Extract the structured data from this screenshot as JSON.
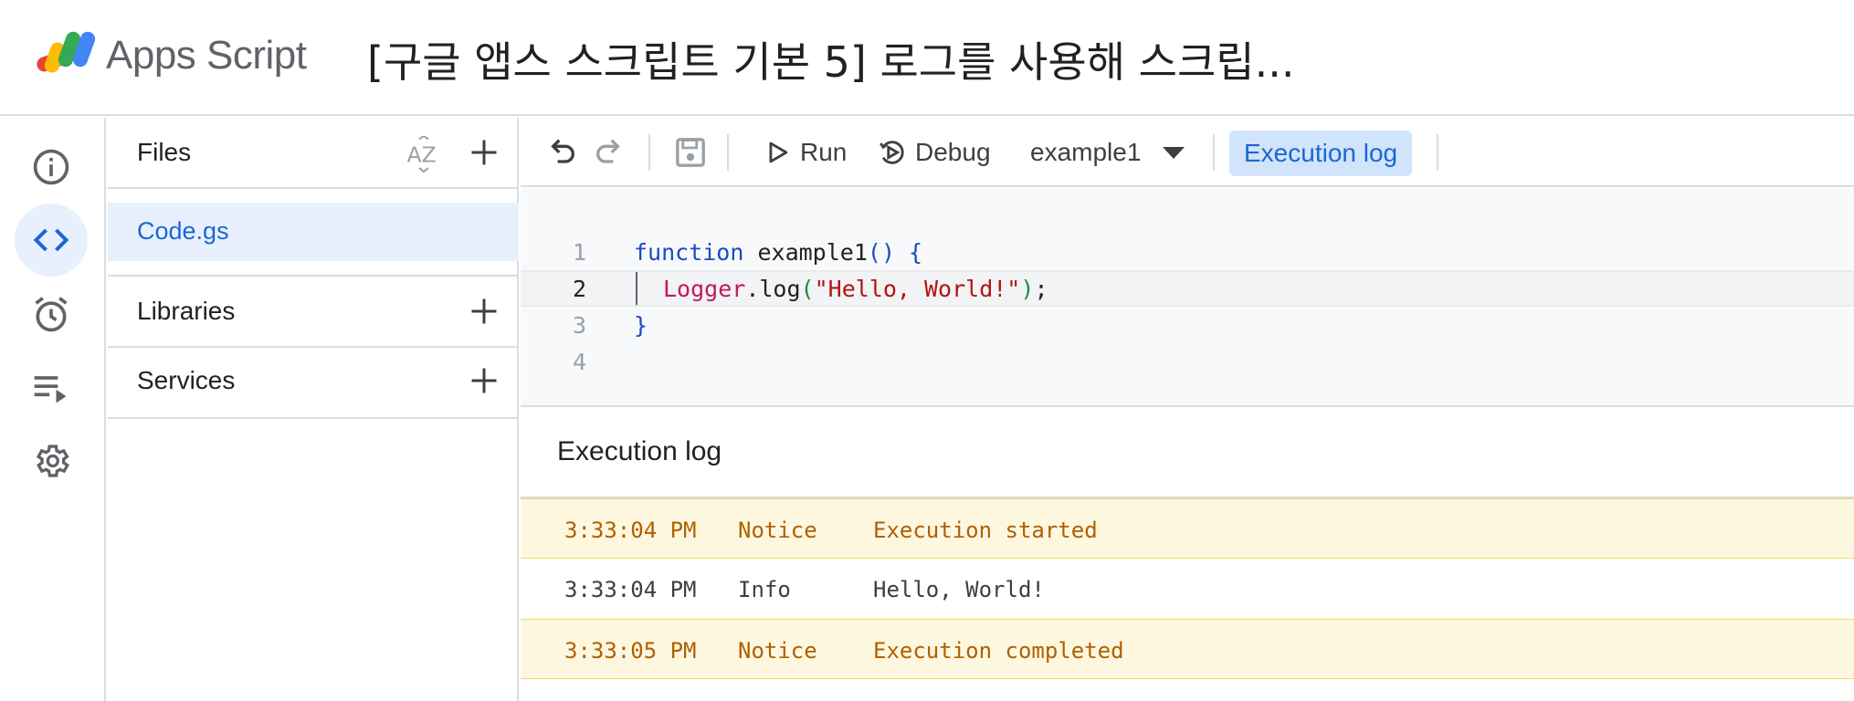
{
  "header": {
    "app_name": "Apps Script",
    "project_title": "[구글 앱스 스크립트 기본 5] 로그를 사용해 스크립..."
  },
  "rail": {
    "items": [
      {
        "icon": "info-icon",
        "label": "Overview"
      },
      {
        "icon": "code-icon",
        "label": "Editor",
        "active": true
      },
      {
        "icon": "alarm-icon",
        "label": "Triggers"
      },
      {
        "icon": "executions-icon",
        "label": "Executions"
      },
      {
        "icon": "gear-icon",
        "label": "Project Settings"
      }
    ]
  },
  "files_panel": {
    "files_title": "Files",
    "files": [
      "Code.gs"
    ],
    "libraries_title": "Libraries",
    "services_title": "Services"
  },
  "toolbar": {
    "run_label": "Run",
    "debug_label": "Debug",
    "function_selected": "example1",
    "execution_log_label": "Execution log"
  },
  "editor": {
    "line_numbers": [
      "1",
      "2",
      "3",
      "4"
    ],
    "line1": {
      "keyword": "function",
      "name": " example1",
      "open": "() {"
    },
    "line2": {
      "object": "Logger",
      "method": ".log",
      "open_paren": "(",
      "string": "\"Hello, World!\"",
      "close_paren": ")",
      "semicolon": ";"
    },
    "line3": {
      "close": "}"
    }
  },
  "execution_log": {
    "title": "Execution log",
    "rows": [
      {
        "time": "3:33:04 PM",
        "level": "Notice",
        "message": "Execution started"
      },
      {
        "time": "3:33:04 PM",
        "level": "Info",
        "message": "Hello, World!"
      },
      {
        "time": "3:33:05 PM",
        "level": "Notice",
        "message": "Execution completed"
      }
    ]
  },
  "colors": {
    "accent": "#1967d2",
    "active_bg": "#e8f0fe",
    "notice_bg": "#fef7e0",
    "notice_text": "#b06000"
  }
}
